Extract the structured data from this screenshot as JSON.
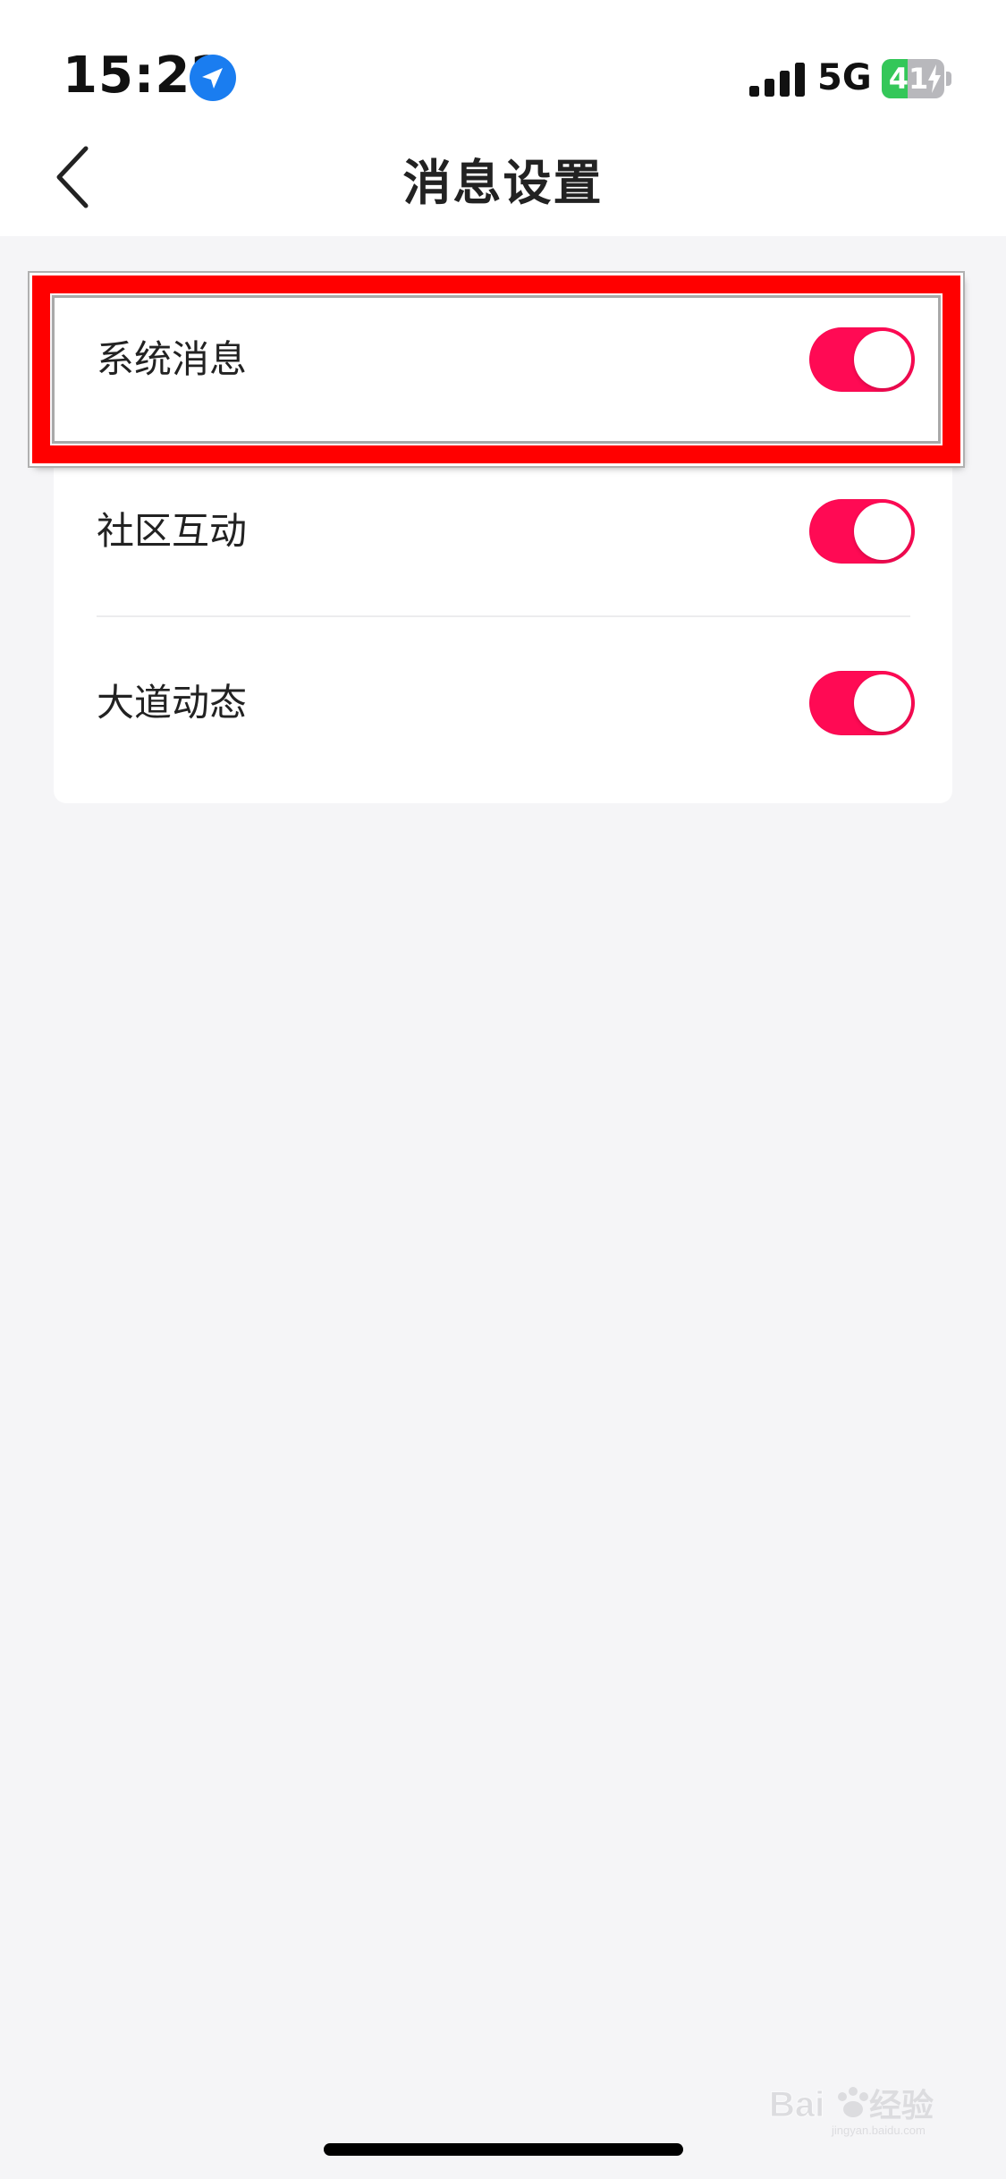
{
  "status_bar": {
    "time": "15:22",
    "network": "5G",
    "battery_percent": "41",
    "battery_level": 0.41,
    "icons": [
      "location-arrow-icon",
      "cellular-signal-icon",
      "battery-charging-icon"
    ]
  },
  "nav": {
    "title": "消息设置",
    "back_icon": "chevron-left-icon"
  },
  "settings": {
    "items": [
      {
        "label": "系统消息",
        "enabled": true
      },
      {
        "label": "社区互动",
        "enabled": true
      },
      {
        "label": "大道动态",
        "enabled": true
      }
    ]
  },
  "colors": {
    "toggle_on": "#ff0a54",
    "highlight": "#ff0000",
    "location_icon": "#1a7df0",
    "battery_fill": "#34c759"
  },
  "watermark": {
    "text": "Baidu经验",
    "subtext": "jingyan.baidu.com"
  }
}
